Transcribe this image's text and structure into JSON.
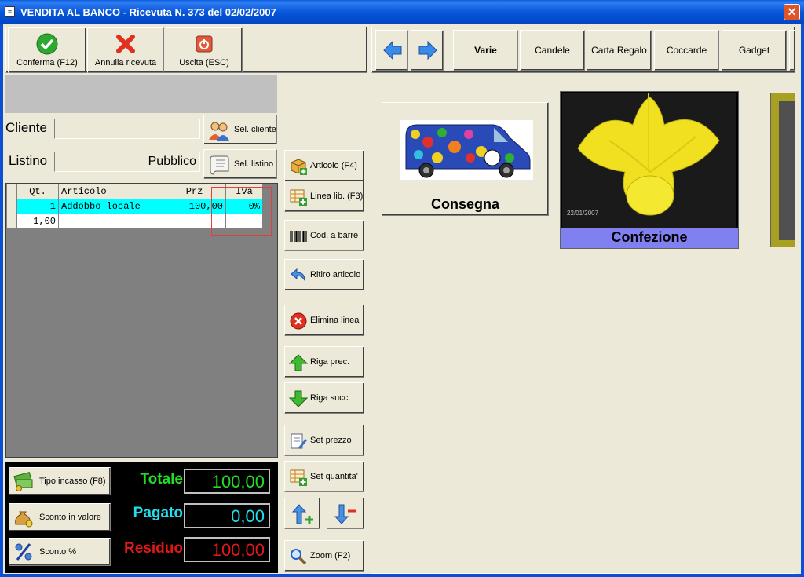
{
  "window": {
    "title": "VENDITA AL BANCO - Ricevuta N. 373 del 02/02/2007",
    "close_label": "✕"
  },
  "toolbar": {
    "confirm_label": "Conferma (F12)",
    "cancel_label": "Annulla ricevuta",
    "exit_label": "Uscita (ESC)"
  },
  "customer": {
    "cliente_label": "Cliente",
    "cliente_value": "",
    "listino_label": "Listino",
    "listino_value": "Pubblico",
    "sel_cliente_label": "Sel. cliente",
    "sel_listino_label": "Sel. listino"
  },
  "grid": {
    "columns": [
      "Qt.",
      "Articolo",
      "Prz",
      "Iva"
    ],
    "rows": [
      {
        "qt": "1",
        "articolo": "Addobbo locale",
        "prz": "100,00",
        "iva": "0%"
      },
      {
        "qt": "1,00",
        "articolo": "",
        "prz": "",
        "iva": ""
      }
    ]
  },
  "actions": {
    "articolo": "Articolo (F4)",
    "linea_lib": "Linea lib. (F3)",
    "cod_barre": "Cod. a barre",
    "ritiro": "Ritiro articolo",
    "elimina": "Elimina linea",
    "riga_prec": "Riga prec.",
    "riga_succ": "Riga succ.",
    "set_prezzo": "Set prezzo",
    "set_quantita": "Set quantita'",
    "zoom": "Zoom (F2)"
  },
  "totals": {
    "tipo_incasso": "Tipo incasso (F8)",
    "sconto_valore": "Sconto in valore",
    "sconto_perc": "Sconto %",
    "totale_label": "Totale",
    "totale_value": "100,00",
    "pagato_label": "Pagato",
    "pagato_value": "0,00",
    "residuo_label": "Residuo",
    "residuo_value": "100,00",
    "colors": {
      "totale": "#22dd22",
      "pagato": "#22ddee",
      "residuo": "#e01818"
    }
  },
  "categories": [
    "Varie",
    "Candele",
    "Carta Regalo",
    "Coccarde",
    "Gadget"
  ],
  "products": [
    {
      "label": "Consegna",
      "icon": "delivery-van-image"
    },
    {
      "label": "Confezione",
      "icon": "yellow-gift-wrap-image",
      "caption_date": "22/01/2007"
    }
  ]
}
